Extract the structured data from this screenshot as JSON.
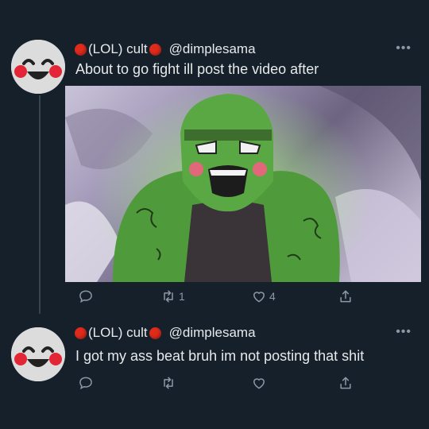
{
  "tweets": [
    {
      "display_name": "(LOL) cult",
      "handle": "@dimplesama",
      "more": "•••",
      "text": "About to go fight ill post the video after",
      "retweets": "1",
      "likes": "4",
      "has_media": true
    },
    {
      "display_name": "(LOL) cult",
      "handle": "@dimplesama",
      "more": "•••",
      "text": "I got my ass beat bruh im not posting that shit",
      "retweets": "",
      "likes": "",
      "has_media": false
    }
  ],
  "icons": {
    "reply": "reply-icon",
    "retweet": "retweet-icon",
    "like": "heart-icon",
    "share": "share-icon",
    "more": "more-icon"
  },
  "colors": {
    "background": "#15202b",
    "text": "#e7e9ea",
    "muted": "#8b98a5",
    "red_dot": "#e02b1c",
    "glow_green": "#7fe05a"
  }
}
